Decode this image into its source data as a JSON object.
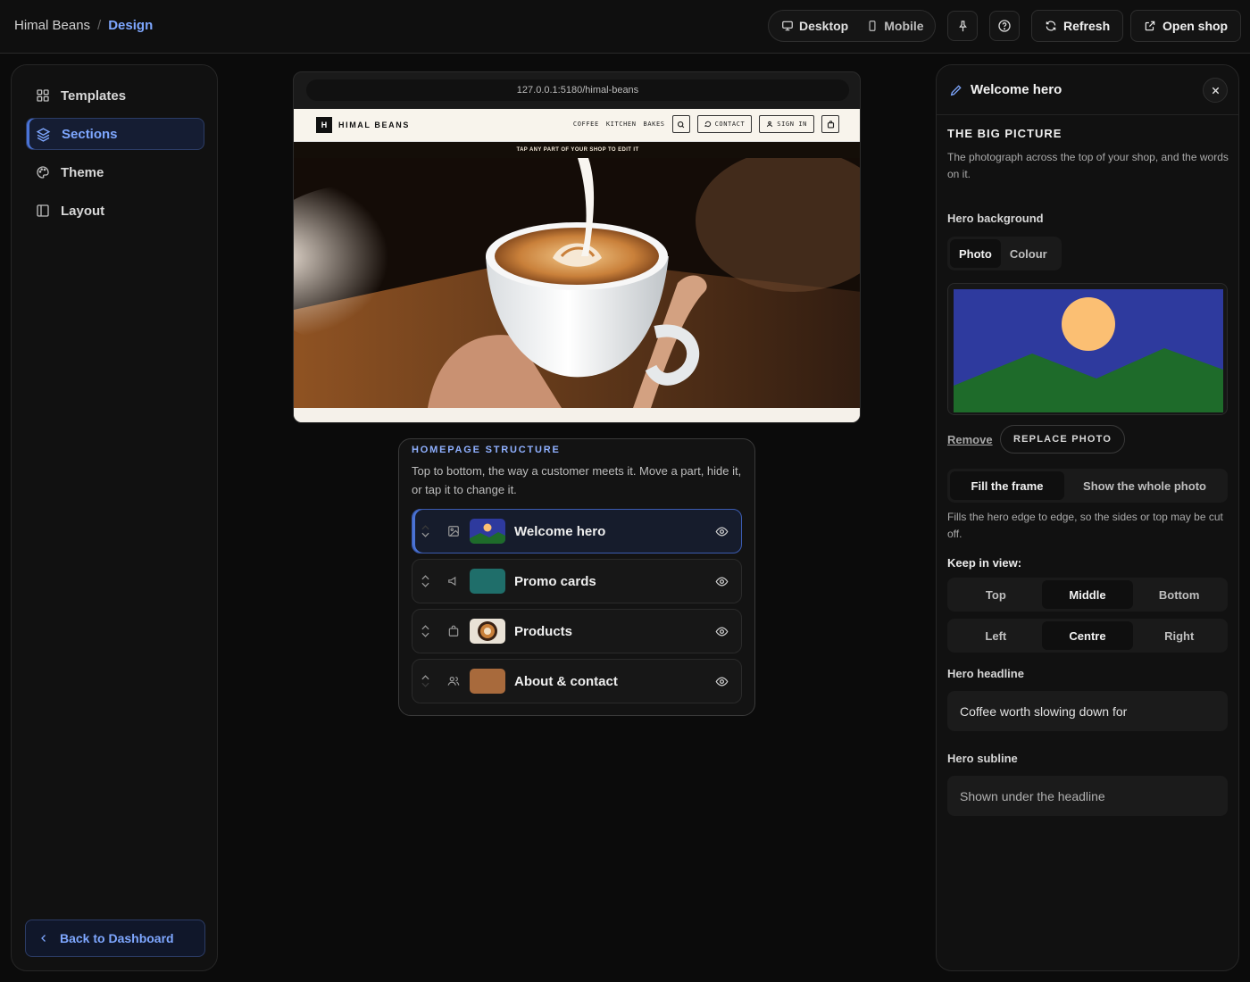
{
  "breadcrumb": {
    "root": "Himal Beans",
    "separator": "/",
    "current": "Design"
  },
  "toolbar": {
    "desktop_label": "Desktop",
    "mobile_label": "Mobile",
    "refresh_label": "Refresh",
    "open_shop_label": "Open shop"
  },
  "sidebar": {
    "items": [
      {
        "label": "Templates",
        "icon": "grid-icon"
      },
      {
        "label": "Sections",
        "icon": "layers-icon"
      },
      {
        "label": "Theme",
        "icon": "palette-icon"
      },
      {
        "label": "Layout",
        "icon": "layout-icon"
      }
    ],
    "active_index": 1,
    "back_label": "Back to Dashboard"
  },
  "preview": {
    "url": "127.0.0.1:5180/himal-beans",
    "logo_letter": "H",
    "logo_text": "HIMAL BEANS",
    "nav": [
      "COFFEE",
      "KITCHEN",
      "BAKES"
    ],
    "contact_label": "CONTACT",
    "signin_label": "SIGN IN",
    "banner": "TAP ANY PART OF YOUR SHOP TO EDIT IT"
  },
  "structure": {
    "title": "HOMEPAGE STRUCTURE",
    "description": "Top to bottom, the way a customer meets it. Move a part, hide it, or tap it to change it.",
    "rows": [
      {
        "label": "Welcome hero",
        "icon": "image-icon",
        "thumb": "hero"
      },
      {
        "label": "Promo cards",
        "icon": "megaphone-icon",
        "thumb": "#1f6e6a"
      },
      {
        "label": "Products",
        "icon": "bag-icon",
        "thumb": "coffee"
      },
      {
        "label": "About & contact",
        "icon": "users-icon",
        "thumb": "#a86a3c"
      }
    ]
  },
  "panel": {
    "title": "Welcome hero",
    "section_title": "THE BIG PICTURE",
    "section_desc": "The photograph across the top of your shop, and the words on it.",
    "hero_background_label": "Hero background",
    "background_tabs": [
      "Photo",
      "Colour"
    ],
    "remove_label": "Remove",
    "replace_label": "REPLACE PHOTO",
    "fit_options": [
      "Fill the frame",
      "Show the whole photo"
    ],
    "fit_hint": "Fills the hero edge to edge, so the sides or top may be cut off.",
    "keep_in_view_label": "Keep in view:",
    "vertical_options": [
      "Top",
      "Middle",
      "Bottom"
    ],
    "horizontal_options": [
      "Left",
      "Centre",
      "Right"
    ],
    "headline_label": "Hero headline",
    "headline_value": "Coffee worth slowing down for",
    "subline_label": "Hero subline",
    "subline_placeholder": "Shown under the headline"
  },
  "colors": {
    "accent": "#7ea7ff",
    "placeholder_sky": "#2e3a9e",
    "placeholder_sun": "#fbbf73",
    "placeholder_hills": "#1e6b2a"
  }
}
